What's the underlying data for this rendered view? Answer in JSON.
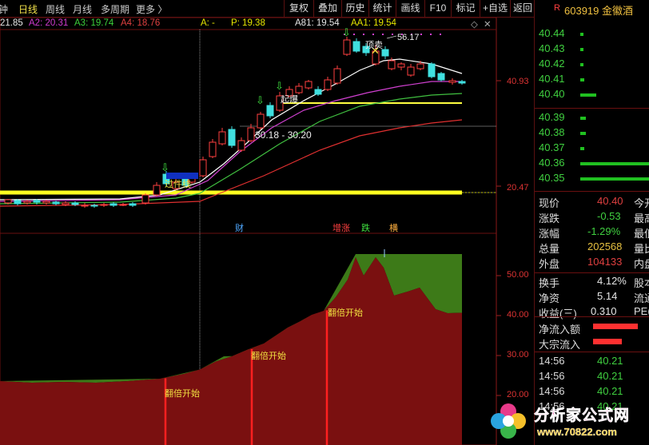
{
  "toolbar": {
    "period_tabs": [
      {
        "label": "钟",
        "active": false
      },
      {
        "label": "日线",
        "active": true
      },
      {
        "label": "周线",
        "active": false
      },
      {
        "label": "月线",
        "active": false
      },
      {
        "label": "多周期",
        "active": false
      },
      {
        "label": "更多 〉",
        "active": false
      }
    ],
    "buttons": [
      "复权",
      "叠加",
      "历史",
      "统计",
      "画线",
      "F10",
      "标记",
      "+自选",
      "返回"
    ]
  },
  "stock": {
    "badge": "R",
    "code_name": "603919 金徽酒"
  },
  "legend": {
    "items": [
      {
        "text": "21.85",
        "color": "#e6e6e6"
      },
      {
        "text": "A2: 20.31",
        "color": "#d23cd2"
      },
      {
        "text": "A3: 19.74",
        "color": "#3cd23c"
      },
      {
        "text": "A4: 18.76",
        "color": "#e04040"
      },
      {
        "text": "A: -",
        "color": "#e6e600"
      },
      {
        "text": "P: 19.38",
        "color": "#e6e600"
      },
      {
        "text": "A81: 19.54",
        "color": "#e6e6e6"
      },
      {
        "text": "AA1: 19.54",
        "color": "#e6e600"
      }
    ],
    "icons": [
      "diamond-icon",
      "close-icon"
    ]
  },
  "price_axis": {
    "upper": "40.93",
    "lower": "20.47"
  },
  "indicator_axis": {
    "ticks": [
      "50.00",
      "40.00",
      "30.00",
      "20.00"
    ],
    "levels": [
      50,
      40,
      30,
      20
    ]
  },
  "annotations": {
    "peak": "56.17",
    "top_sell": "顶卖",
    "breakout": "起爆",
    "cross_line": "过件线",
    "range": "30.18 - 30.20",
    "event_markers": [
      {
        "text": "财",
        "color": "#4fa8ff"
      },
      {
        "text": "增涨",
        "color": "#ff4040"
      },
      {
        "text": "跌",
        "color": "#40e040"
      },
      {
        "text": "横",
        "color": "#ffb040"
      }
    ],
    "double_start": "翻倍开始"
  },
  "depth": {
    "asks": [
      {
        "price": "40.44",
        "qty_level": 0.03
      },
      {
        "price": "40.43",
        "qty_level": 0.03
      },
      {
        "price": "40.42",
        "qty_level": 0.03
      },
      {
        "price": "40.41",
        "qty_level": 0.06
      },
      {
        "price": "40.40",
        "qty_level": 0.25
      }
    ],
    "bids": [
      {
        "price": "40.39",
        "qty_level": 0.08
      },
      {
        "price": "40.38",
        "qty_level": 0.08
      },
      {
        "price": "40.37",
        "qty_level": 0.06
      },
      {
        "price": "40.36",
        "qty_level": 1.0
      },
      {
        "price": "40.35",
        "qty_level": 1.0
      }
    ]
  },
  "quote": [
    {
      "label": "现价",
      "value": "40.40",
      "value_color": "#e04040",
      "trail": "今开"
    },
    {
      "label": "涨跌",
      "value": "-0.53",
      "value_color": "#40d040",
      "trail": "最高"
    },
    {
      "label": "涨幅",
      "value": "-1.29%",
      "value_color": "#40d040",
      "trail": "最低"
    },
    {
      "label": "总量",
      "value": "202568",
      "value_color": "#e6c040",
      "trail": "量比"
    },
    {
      "label": "外盘",
      "value": "104133",
      "value_color": "#e04040",
      "trail": "内盘"
    },
    {
      "label": "换手",
      "value": "4.12%",
      "value_color": "#e6e6e6",
      "trail": "股本"
    },
    {
      "label": "净资",
      "value": "5.14",
      "value_color": "#e6e6e6",
      "trail": "流通"
    },
    {
      "label": "收益(三)",
      "value": "0.310",
      "value_color": "#e6e6e6",
      "trail": "PE("
    }
  ],
  "flows": [
    {
      "label": "净流入额",
      "bar_level": 0.85
    },
    {
      "label": "大宗流入",
      "bar_level": 0.55
    }
  ],
  "ticks": [
    {
      "time": "14:56",
      "price": "40.21"
    },
    {
      "time": "14:56",
      "price": "40.21"
    },
    {
      "time": "14:56",
      "price": "40.21"
    },
    {
      "time": "14:56",
      "price": "40.21"
    }
  ],
  "watermark": {
    "title": "分析家公式网",
    "url": "www.70822.com"
  }
}
